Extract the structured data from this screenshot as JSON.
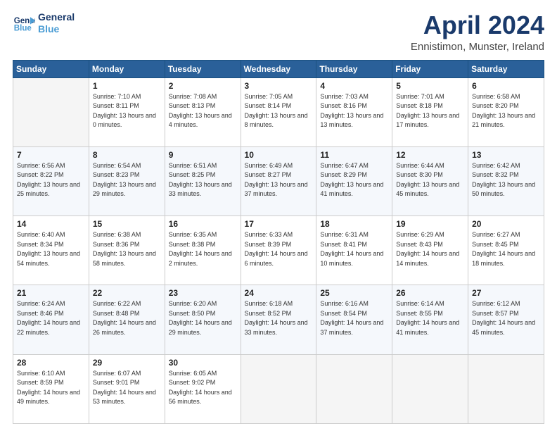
{
  "header": {
    "logo_line1": "General",
    "logo_line2": "Blue",
    "title": "April 2024",
    "subtitle": "Ennistimon, Munster, Ireland"
  },
  "columns": [
    "Sunday",
    "Monday",
    "Tuesday",
    "Wednesday",
    "Thursday",
    "Friday",
    "Saturday"
  ],
  "weeks": [
    [
      {
        "day": "",
        "sunrise": "",
        "sunset": "",
        "daylight": ""
      },
      {
        "day": "1",
        "sunrise": "7:10 AM",
        "sunset": "8:11 PM",
        "daylight": "13 hours and 0 minutes."
      },
      {
        "day": "2",
        "sunrise": "7:08 AM",
        "sunset": "8:13 PM",
        "daylight": "13 hours and 4 minutes."
      },
      {
        "day": "3",
        "sunrise": "7:05 AM",
        "sunset": "8:14 PM",
        "daylight": "13 hours and 8 minutes."
      },
      {
        "day": "4",
        "sunrise": "7:03 AM",
        "sunset": "8:16 PM",
        "daylight": "13 hours and 13 minutes."
      },
      {
        "day": "5",
        "sunrise": "7:01 AM",
        "sunset": "8:18 PM",
        "daylight": "13 hours and 17 minutes."
      },
      {
        "day": "6",
        "sunrise": "6:58 AM",
        "sunset": "8:20 PM",
        "daylight": "13 hours and 21 minutes."
      }
    ],
    [
      {
        "day": "7",
        "sunrise": "6:56 AM",
        "sunset": "8:22 PM",
        "daylight": "13 hours and 25 minutes."
      },
      {
        "day": "8",
        "sunrise": "6:54 AM",
        "sunset": "8:23 PM",
        "daylight": "13 hours and 29 minutes."
      },
      {
        "day": "9",
        "sunrise": "6:51 AM",
        "sunset": "8:25 PM",
        "daylight": "13 hours and 33 minutes."
      },
      {
        "day": "10",
        "sunrise": "6:49 AM",
        "sunset": "8:27 PM",
        "daylight": "13 hours and 37 minutes."
      },
      {
        "day": "11",
        "sunrise": "6:47 AM",
        "sunset": "8:29 PM",
        "daylight": "13 hours and 41 minutes."
      },
      {
        "day": "12",
        "sunrise": "6:44 AM",
        "sunset": "8:30 PM",
        "daylight": "13 hours and 45 minutes."
      },
      {
        "day": "13",
        "sunrise": "6:42 AM",
        "sunset": "8:32 PM",
        "daylight": "13 hours and 50 minutes."
      }
    ],
    [
      {
        "day": "14",
        "sunrise": "6:40 AM",
        "sunset": "8:34 PM",
        "daylight": "13 hours and 54 minutes."
      },
      {
        "day": "15",
        "sunrise": "6:38 AM",
        "sunset": "8:36 PM",
        "daylight": "13 hours and 58 minutes."
      },
      {
        "day": "16",
        "sunrise": "6:35 AM",
        "sunset": "8:38 PM",
        "daylight": "14 hours and 2 minutes."
      },
      {
        "day": "17",
        "sunrise": "6:33 AM",
        "sunset": "8:39 PM",
        "daylight": "14 hours and 6 minutes."
      },
      {
        "day": "18",
        "sunrise": "6:31 AM",
        "sunset": "8:41 PM",
        "daylight": "14 hours and 10 minutes."
      },
      {
        "day": "19",
        "sunrise": "6:29 AM",
        "sunset": "8:43 PM",
        "daylight": "14 hours and 14 minutes."
      },
      {
        "day": "20",
        "sunrise": "6:27 AM",
        "sunset": "8:45 PM",
        "daylight": "14 hours and 18 minutes."
      }
    ],
    [
      {
        "day": "21",
        "sunrise": "6:24 AM",
        "sunset": "8:46 PM",
        "daylight": "14 hours and 22 minutes."
      },
      {
        "day": "22",
        "sunrise": "6:22 AM",
        "sunset": "8:48 PM",
        "daylight": "14 hours and 26 minutes."
      },
      {
        "day": "23",
        "sunrise": "6:20 AM",
        "sunset": "8:50 PM",
        "daylight": "14 hours and 29 minutes."
      },
      {
        "day": "24",
        "sunrise": "6:18 AM",
        "sunset": "8:52 PM",
        "daylight": "14 hours and 33 minutes."
      },
      {
        "day": "25",
        "sunrise": "6:16 AM",
        "sunset": "8:54 PM",
        "daylight": "14 hours and 37 minutes."
      },
      {
        "day": "26",
        "sunrise": "6:14 AM",
        "sunset": "8:55 PM",
        "daylight": "14 hours and 41 minutes."
      },
      {
        "day": "27",
        "sunrise": "6:12 AM",
        "sunset": "8:57 PM",
        "daylight": "14 hours and 45 minutes."
      }
    ],
    [
      {
        "day": "28",
        "sunrise": "6:10 AM",
        "sunset": "8:59 PM",
        "daylight": "14 hours and 49 minutes."
      },
      {
        "day": "29",
        "sunrise": "6:07 AM",
        "sunset": "9:01 PM",
        "daylight": "14 hours and 53 minutes."
      },
      {
        "day": "30",
        "sunrise": "6:05 AM",
        "sunset": "9:02 PM",
        "daylight": "14 hours and 56 minutes."
      },
      {
        "day": "",
        "sunrise": "",
        "sunset": "",
        "daylight": ""
      },
      {
        "day": "",
        "sunrise": "",
        "sunset": "",
        "daylight": ""
      },
      {
        "day": "",
        "sunrise": "",
        "sunset": "",
        "daylight": ""
      },
      {
        "day": "",
        "sunrise": "",
        "sunset": "",
        "daylight": ""
      }
    ]
  ],
  "labels": {
    "sunrise_prefix": "Sunrise: ",
    "sunset_prefix": "Sunset: ",
    "daylight_prefix": "Daylight: "
  }
}
